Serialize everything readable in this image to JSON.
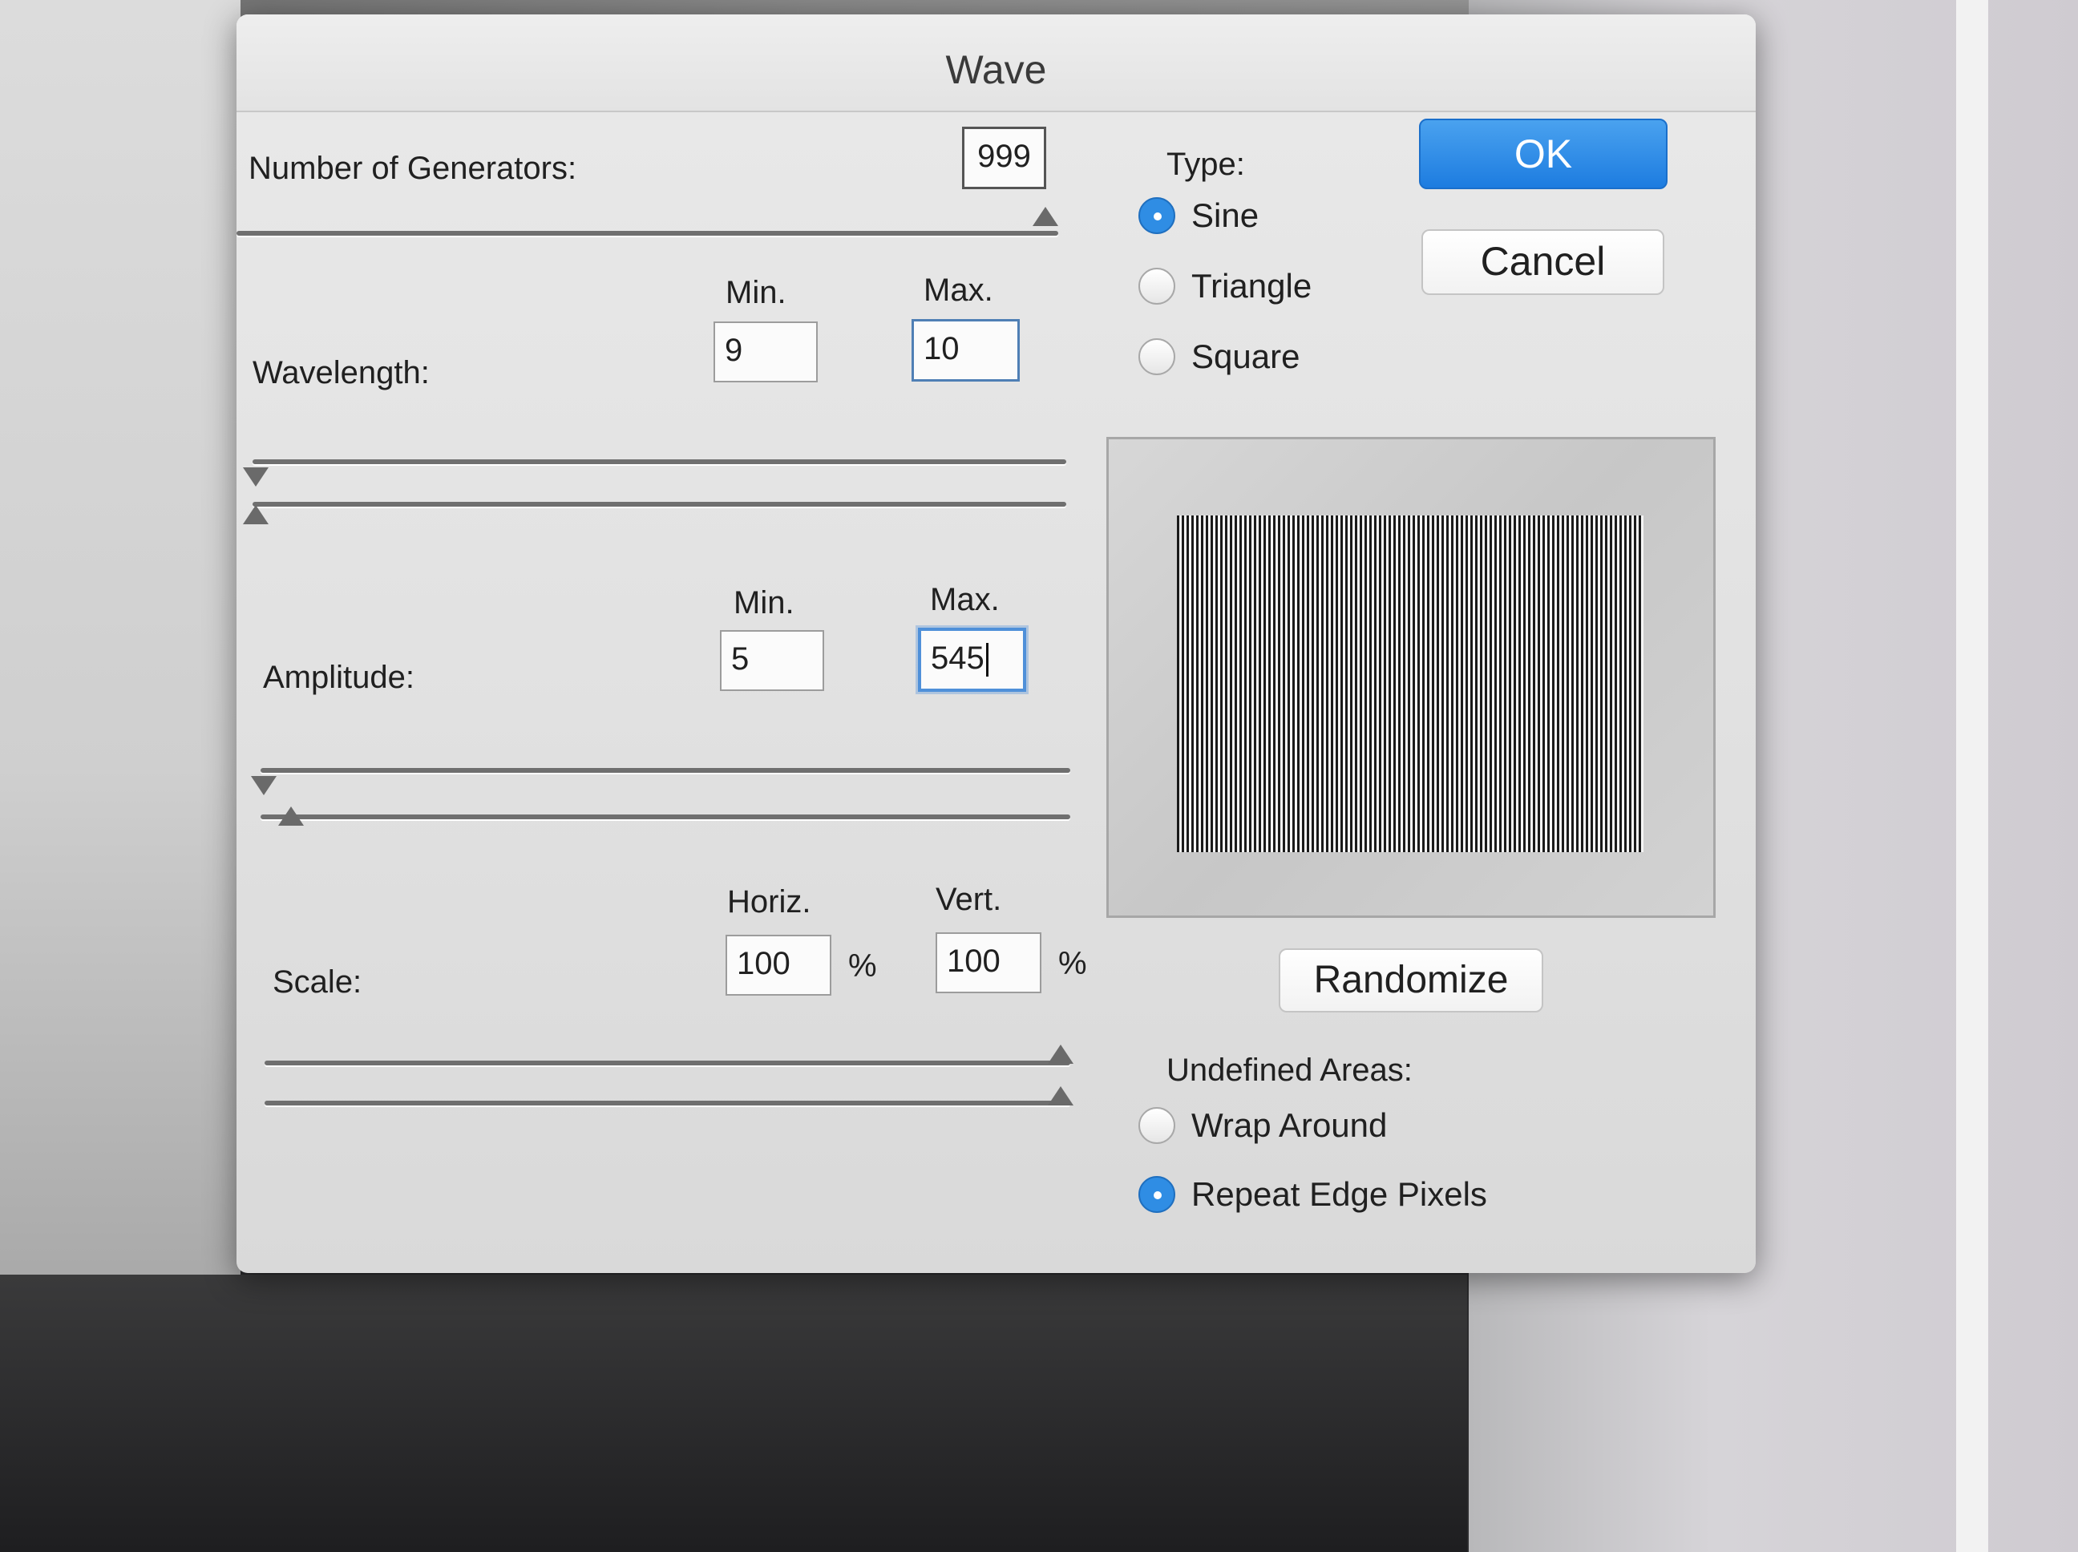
{
  "dialog": {
    "title": "Wave"
  },
  "generators": {
    "label": "Number of Generators:",
    "value": "999",
    "slider_fraction": 1.0
  },
  "wavelength": {
    "label": "Wavelength:",
    "min_label": "Min.",
    "max_label": "Max.",
    "min_value": "9",
    "max_value": "10"
  },
  "amplitude": {
    "label": "Amplitude:",
    "min_label": "Min.",
    "max_label": "Max.",
    "min_value": "5",
    "max_value": "545"
  },
  "scale": {
    "label": "Scale:",
    "horiz_label": "Horiz.",
    "vert_label": "Vert.",
    "horiz_value": "100",
    "vert_value": "100",
    "percent": "%"
  },
  "type": {
    "label": "Type:",
    "options": [
      "Sine",
      "Triangle",
      "Square"
    ],
    "selected": "Sine"
  },
  "buttons": {
    "ok": "OK",
    "cancel": "Cancel",
    "randomize": "Randomize"
  },
  "undefined_areas": {
    "label": "Undefined Areas:",
    "options": [
      "Wrap Around",
      "Repeat Edge Pixels"
    ],
    "selected": "Repeat Edge Pixels"
  },
  "colors": {
    "accent": "#2f8de4",
    "ok_button": "#1d7ce0"
  }
}
